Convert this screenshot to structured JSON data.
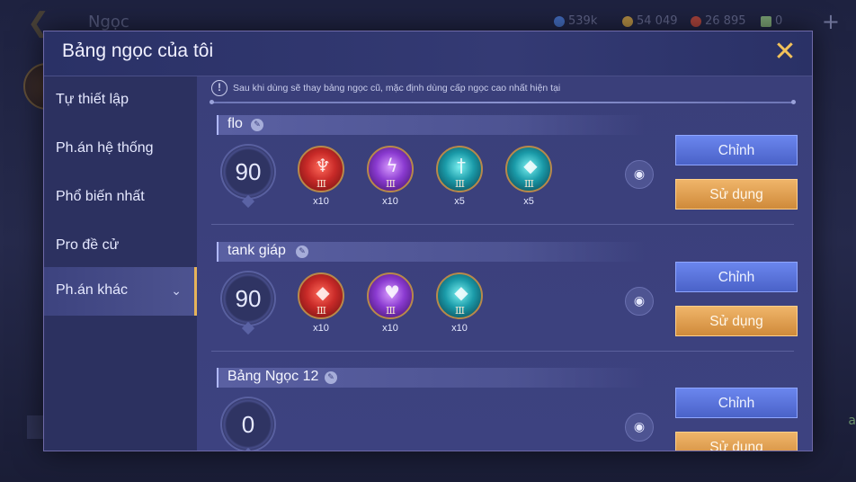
{
  "background": {
    "title": "Ngọc",
    "resources": [
      {
        "value": "539k",
        "color": "#4a7bd8",
        "icon": "gem-icon"
      },
      {
        "value": "54 049",
        "color": "#d4a544",
        "icon": "gold-coin-icon"
      },
      {
        "value": "26 895",
        "color": "#c84a3a",
        "icon": "ruby-icon"
      },
      {
        "value": "0",
        "color": "#8fbf7f",
        "icon": "card-icon"
      }
    ],
    "side_text": "a"
  },
  "modal": {
    "title": "Bảng ngọc của tôi",
    "info": "Sau khi dùng sẽ thay bảng ngọc cũ, mặc định dùng cấp ngọc cao nhất hiện tại"
  },
  "sidebar": {
    "items": [
      {
        "label": "Tự thiết lập"
      },
      {
        "label": "Ph.án hệ thống"
      },
      {
        "label": "Phổ biến nhất"
      },
      {
        "label": "Pro đề cử"
      },
      {
        "label": "Ph.án khác"
      }
    ]
  },
  "pages": [
    {
      "name": "flo",
      "level": "90",
      "gems": [
        {
          "color": "red",
          "symbol": "claw",
          "tier": "III",
          "count": "x10"
        },
        {
          "color": "purple",
          "symbol": "lightning",
          "tier": "III",
          "count": "x10"
        },
        {
          "color": "teal",
          "symbol": "sword",
          "tier": "III",
          "count": "x5"
        },
        {
          "color": "teal",
          "symbol": "crystal",
          "tier": "III",
          "count": "x5"
        }
      ],
      "edit_label": "Chỉnh",
      "use_label": "Sử dụng"
    },
    {
      "name": "tank giáp",
      "level": "90",
      "gems": [
        {
          "color": "red",
          "symbol": "crystal",
          "tier": "III",
          "count": "x10"
        },
        {
          "color": "purple",
          "symbol": "heart",
          "tier": "III",
          "count": "x10"
        },
        {
          "color": "teal",
          "symbol": "crystal",
          "tier": "III",
          "count": "x10"
        }
      ],
      "edit_label": "Chỉnh",
      "use_label": "Sử dụng"
    },
    {
      "name": "Bảng Ngọc 12",
      "level": "0",
      "gems": [],
      "edit_label": "Chỉnh",
      "use_label": "Sử dụng"
    }
  ]
}
